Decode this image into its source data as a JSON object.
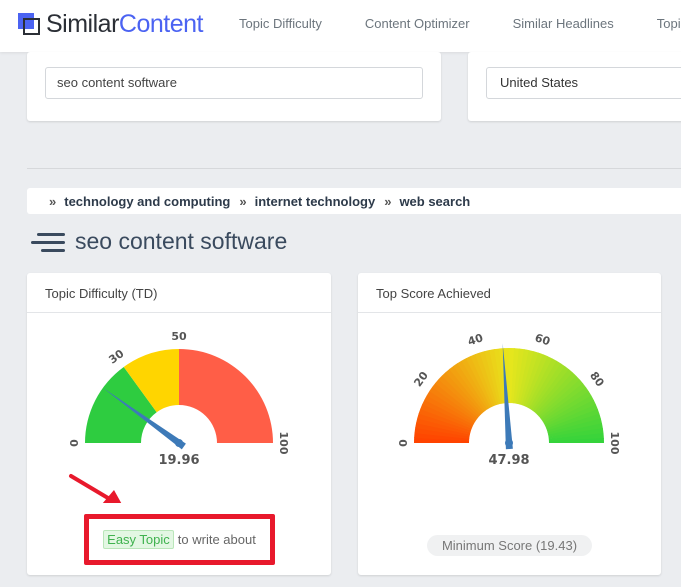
{
  "app": {
    "logo_part1": "Similar",
    "logo_part2": "Content",
    "colors": {
      "brand": "#4b63f2",
      "dark": "#2b2f36"
    }
  },
  "nav": {
    "items": [
      "Topic Difficulty",
      "Content Optimizer",
      "Similar Headlines",
      "Topic"
    ]
  },
  "search": {
    "value": "seo content software"
  },
  "country": {
    "value": "United States"
  },
  "breadcrumb": {
    "separator": "»",
    "items": [
      "technology and computing",
      "internet technology",
      "web search"
    ]
  },
  "page": {
    "title": "seo content software"
  },
  "topic_difficulty": {
    "title": "Topic Difficulty (TD)",
    "value": 19.96,
    "value_label": "19.96",
    "tick_labels": [
      "0",
      "30",
      "50",
      "100"
    ],
    "colors": {
      "easy": "#2ecc40",
      "medium": "#ffd500",
      "hard": "#ff5e47",
      "needle": "#3d7ab8"
    },
    "badge": "Easy Topic",
    "badge_suffix": "to write about"
  },
  "top_score": {
    "title": "Top Score Achieved",
    "value": 47.98,
    "value_label": "47.98",
    "tick_labels": [
      "0",
      "20",
      "40",
      "60",
      "80",
      "100"
    ],
    "min_score_label": "Minimum Score (19.43)",
    "colors": {
      "low": "#ff4000",
      "mid": "#e8e61c",
      "high": "#32d33c",
      "needle": "#3d7ab8"
    }
  }
}
